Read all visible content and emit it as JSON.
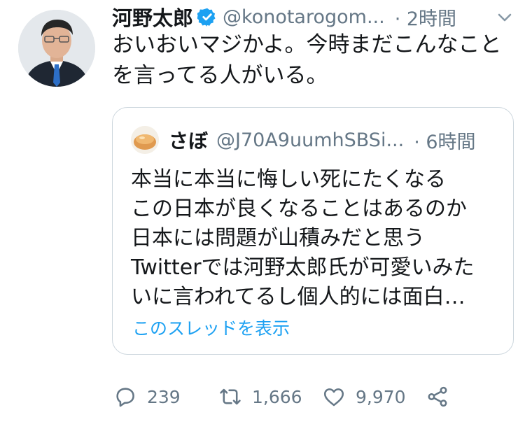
{
  "tweet": {
    "author_name": "河野太郎",
    "handle": "@konotarogom...",
    "time": "· 2時間",
    "text_lines": [
      "おいおいマジかよ。今時まだこんなこと",
      "を言ってる人がいる。"
    ],
    "verified": true
  },
  "quoted_tweet": {
    "author_name": "さぼ",
    "handle": "@J70A9uumhSBSi...",
    "time": "· 6時間",
    "text_lines": [
      "本当に本当に悔しい死にたくなる",
      "この日本が良くなることはあるのか",
      "日本には問題が山積みだと思う",
      "Twitterでは河野太郎氏が可愛いみた",
      "いに言われてるし個人的には面白…"
    ],
    "show_thread_label": "このスレッドを表示"
  },
  "actions": {
    "replies": "239",
    "retweets": "1,666",
    "likes": "9,970"
  },
  "icons": [
    "verified-badge-icon",
    "chevron-down-icon",
    "reply-icon",
    "retweet-icon",
    "like-icon",
    "share-icon"
  ],
  "colors": {
    "accent": "#1da1f2",
    "muted": "#657786",
    "text": "#14171a",
    "border": "#ccd6dd"
  }
}
